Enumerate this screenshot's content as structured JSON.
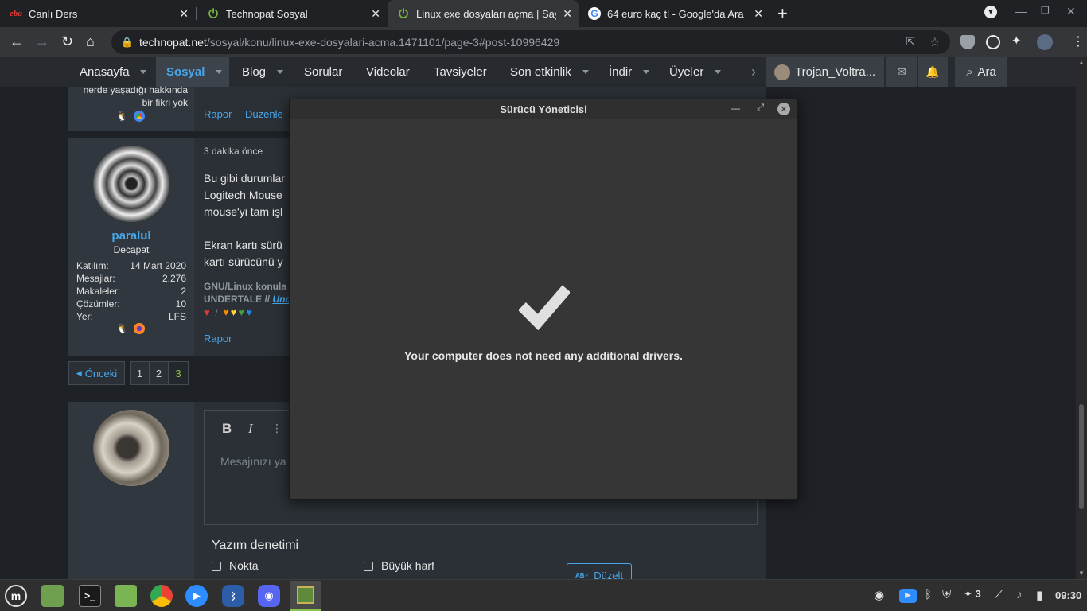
{
  "tabs": [
    {
      "title": "Canlı Ders",
      "icon": "eba-icon"
    },
    {
      "title": "Technopat Sosyal",
      "icon": "power-icon"
    },
    {
      "title": "Linux exe dosyaları açma | Say",
      "icon": "power-icon"
    },
    {
      "title": "64 euro kaç tl - Google'da Ara",
      "icon": "google-icon"
    }
  ],
  "address": {
    "host": "technopat.net",
    "path": "/sosyal/konu/linux-exe-dosyalari-acma.1471101/page-3#post-10996429"
  },
  "nav": {
    "items": [
      "Anasayfa",
      "Sosyal",
      "Blog",
      "Sorular",
      "Videolar",
      "Tavsiyeler",
      "Son etkinlik",
      "İndir",
      "Üyeler"
    ],
    "user": "Trojan_Voltra...",
    "search": "Ara"
  },
  "post1": {
    "loc_line1": "nerde yaşadığı hakkında",
    "loc_line2": "bir fikri yok",
    "report": "Rapor",
    "edit": "Düzenle"
  },
  "post2": {
    "username": "paralul",
    "rank": "Decapat",
    "stats": [
      {
        "k": "Katılım:",
        "v": "14 Mart 2020"
      },
      {
        "k": "Mesajlar:",
        "v": "2.276"
      },
      {
        "k": "Makaleler:",
        "v": "2"
      },
      {
        "k": "Çözümler:",
        "v": "10"
      },
      {
        "k": "Yer:",
        "v": "LFS"
      }
    ],
    "time": "3 dakika önce",
    "body": [
      "Bu gibi durumlar",
      "Logitech Mouse",
      "mouse'yi tam işl",
      "Ekran kartı sürü",
      "kartı sürücünü y"
    ],
    "sig1": "GNU/Linux konula",
    "sig2": "UNDERTALE // ",
    "sig2_link": "Und",
    "report": "Rapor"
  },
  "pagination": {
    "prev": "Önceki",
    "pages": [
      "1",
      "2",
      "3"
    ],
    "current": "3"
  },
  "editor": {
    "placeholder": "Mesajınızı ya"
  },
  "spell": {
    "title": "Yazım denetimi",
    "opt1": "Nokta",
    "opt2": "Büyük harf",
    "fix": "Düzelt"
  },
  "dialog": {
    "title": "Sürücü Yöneticisi",
    "message": "Your computer does not need any additional drivers."
  },
  "taskbar": {
    "time": "09:30",
    "tray_count": "3"
  }
}
